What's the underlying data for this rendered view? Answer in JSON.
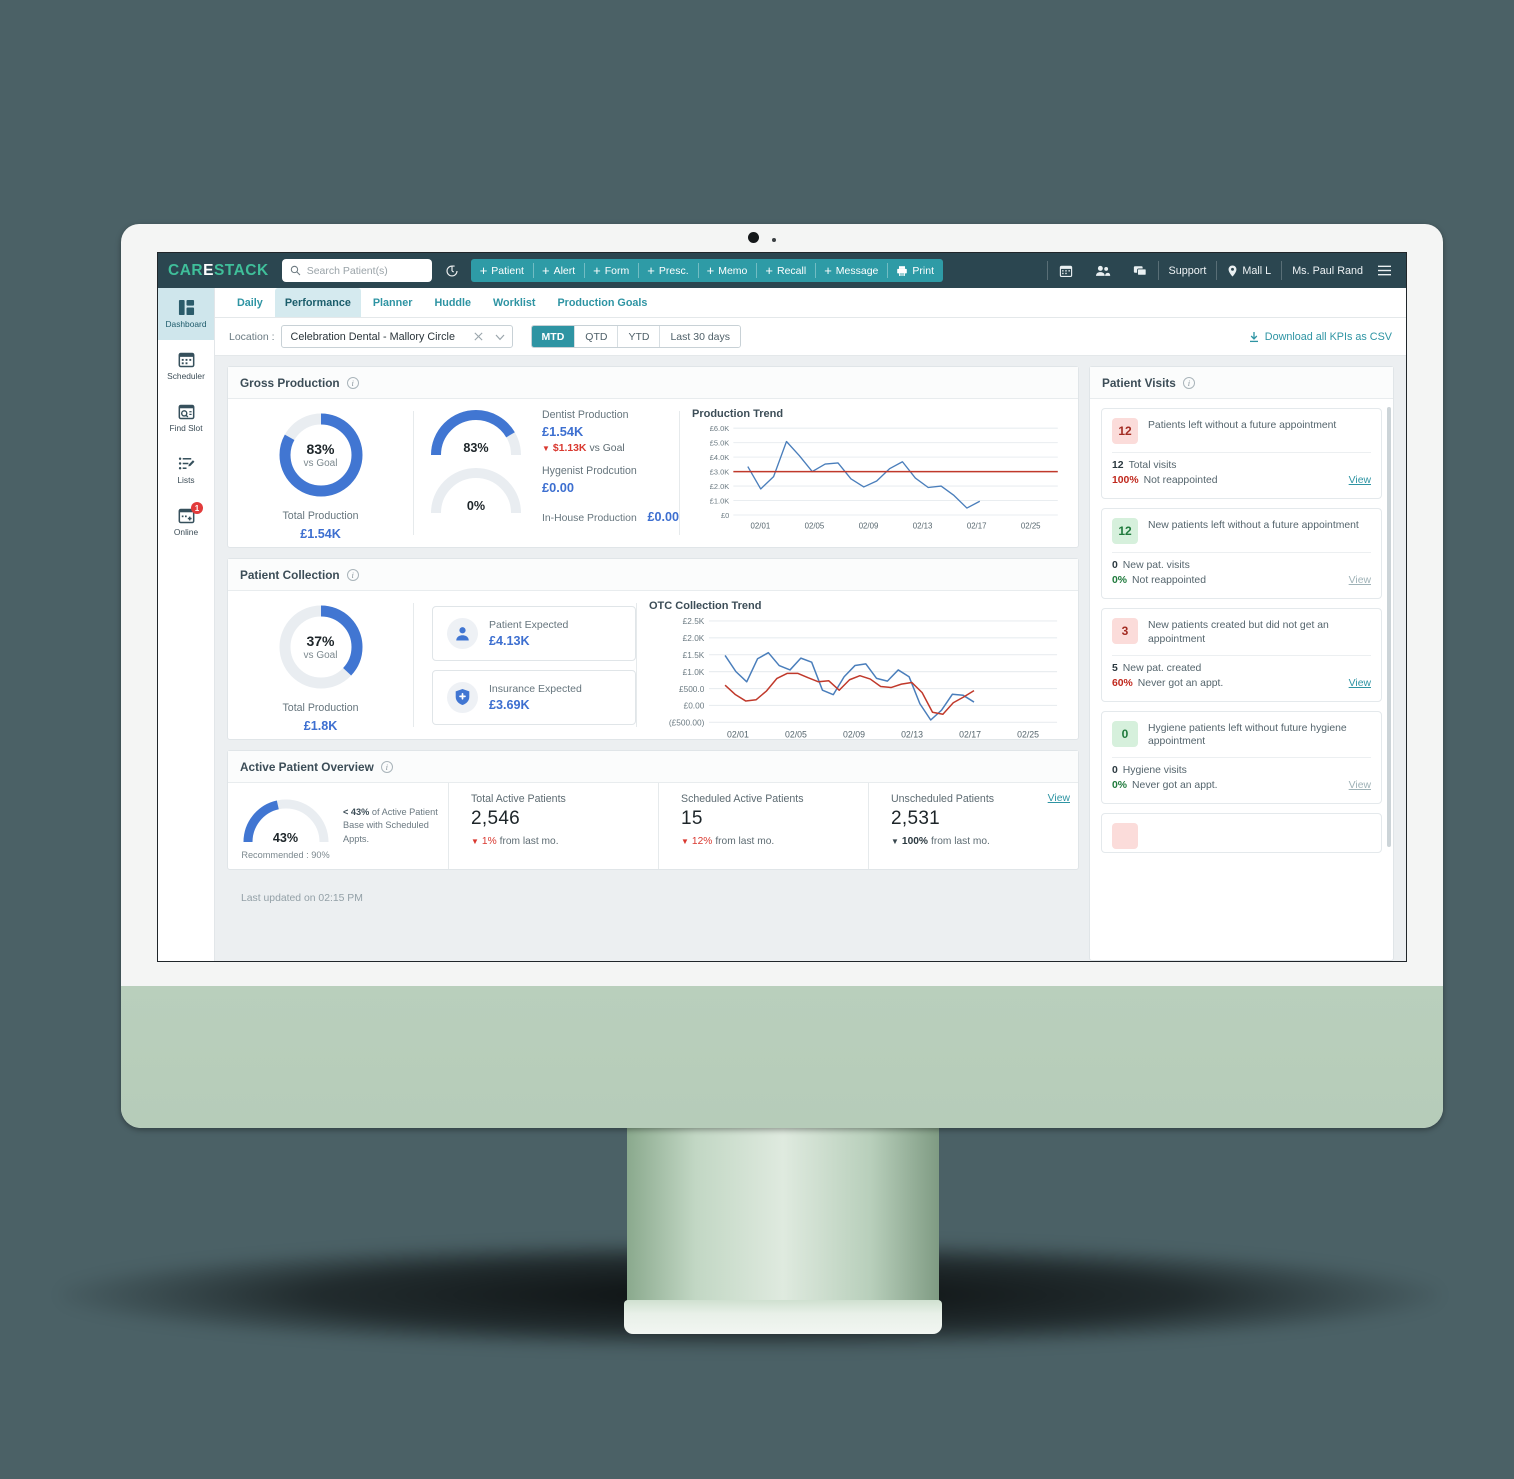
{
  "topbar": {
    "logo": {
      "part1": "CAR",
      "part2": "E",
      "part3": "STACK"
    },
    "search_placeholder": "Search Patient(s)",
    "search_value": "",
    "clock_icon": "recent-history-icon",
    "actions": [
      {
        "label": "Patient",
        "icon": "plus-icon"
      },
      {
        "label": "Alert",
        "icon": "plus-icon"
      },
      {
        "label": "Form",
        "icon": "plus-icon"
      },
      {
        "label": "Presc.",
        "icon": "plus-icon"
      },
      {
        "label": "Memo",
        "icon": "plus-icon"
      },
      {
        "label": "Recall",
        "icon": "plus-icon"
      },
      {
        "label": "Message",
        "icon": "plus-icon"
      },
      {
        "label": "Print",
        "icon": "printer-icon"
      }
    ],
    "right_icons": [
      "calendar-icon",
      "people-icon",
      "chat-icon"
    ],
    "support_label": "Support",
    "location_label": "Mall L",
    "user_label": "Ms. Paul Rand",
    "menu_icon": "hamburger-icon"
  },
  "rail": [
    {
      "label": "Dashboard",
      "icon": "dashboard-icon",
      "active": true,
      "badge": ""
    },
    {
      "label": "Scheduler",
      "icon": "calendar-icon",
      "active": false,
      "badge": ""
    },
    {
      "label": "Find Slot",
      "icon": "calendar-search-icon",
      "active": false,
      "badge": ""
    },
    {
      "label": "Lists",
      "icon": "list-edit-icon",
      "active": false,
      "badge": ""
    },
    {
      "label": "Online",
      "icon": "calendar-plus-icon",
      "active": false,
      "badge": "1"
    }
  ],
  "tabs": [
    {
      "label": "Daily",
      "active": false
    },
    {
      "label": "Performance",
      "active": true
    },
    {
      "label": "Planner",
      "active": false
    },
    {
      "label": "Huddle",
      "active": false
    },
    {
      "label": "Worklist",
      "active": false
    },
    {
      "label": "Production Goals",
      "active": false
    }
  ],
  "filterbar": {
    "location_label": "Location :",
    "location_value": "Celebration Dental - Mallory Circle",
    "clear_icon": "close-icon",
    "dropdown_icon": "chevron-down-icon",
    "ranges": [
      {
        "label": "MTD",
        "active": true
      },
      {
        "label": "QTD",
        "active": false
      },
      {
        "label": "YTD",
        "active": false
      },
      {
        "label": "Last 30 days",
        "active": false
      }
    ],
    "csv_label": "Download all KPIs as CSV",
    "csv_icon": "download-icon"
  },
  "gross_production": {
    "title": "Gross Production",
    "donut": {
      "percent": 83,
      "percent_label": "83%",
      "sub": "vs Goal"
    },
    "caption": "Total Production",
    "value": "£1.54K",
    "gauges": [
      {
        "percent": 83,
        "percent_label": "83%",
        "caption": ""
      },
      {
        "percent": 0,
        "percent_label": "0%",
        "caption": "In-House Production"
      }
    ],
    "dentist_label": "Dentist Production",
    "dentist_value": "£1.54K",
    "dentist_delta_amount": "$1.13K",
    "dentist_delta_suffix": "vs Goal",
    "hygenist_label": "Hygenist Prodcution",
    "hygenist_value": "£0.00",
    "inhouse_label": "In-House Production",
    "inhouse_value": "£0.00"
  },
  "patient_collection": {
    "title": "Patient Collection",
    "donut": {
      "percent": 37,
      "percent_label": "37%",
      "sub": "vs Goal"
    },
    "caption": "Total Production",
    "value": "£1.8K",
    "tiles": [
      {
        "label": "Patient Expected",
        "value": "£4.13K",
        "icon": "person-icon"
      },
      {
        "label": "Insurance Expected",
        "value": "£3.69K",
        "icon": "shield-plus-icon"
      }
    ]
  },
  "active_patient_overview": {
    "title": "Active Patient Overview",
    "gauge": {
      "percent": 43,
      "percent_label": "43%"
    },
    "recommended": "Recommended : 90%",
    "note_prefix": "< 43%",
    "note_rest": " of Active Patient Base with Scheduled Appts.",
    "metrics": [
      {
        "label": "Total Active Patients",
        "value": "2,546",
        "delta": "1%",
        "delta_suffix": "from last mo.",
        "view": ""
      },
      {
        "label": "Scheduled Active Patients",
        "value": "15",
        "delta": "12%",
        "delta_suffix": "from last mo.",
        "view": ""
      },
      {
        "label": "Unscheduled Patients",
        "value": "2,531",
        "delta": "100%",
        "delta_suffix": "from last mo.",
        "view": "View"
      }
    ]
  },
  "footer": {
    "last_updated": "Last updated on 02:15 PM"
  },
  "patient_visits": {
    "title": "Patient Visits",
    "items": [
      {
        "badge": "12",
        "badge_color": "red",
        "desc": "Patients left without a future appointment",
        "stat1_value": "12",
        "stat1_label": "Total visits",
        "stat2_value": "100%",
        "stat2_label": "Not reappointed",
        "stat2_color": "red",
        "view": "View",
        "view_muted": false
      },
      {
        "badge": "12",
        "badge_color": "green",
        "desc": "New patients left without a future appointment",
        "stat1_value": "0",
        "stat1_label": "New pat. visits",
        "stat2_value": "0%",
        "stat2_label": "Not reappointed",
        "stat2_color": "green",
        "view": "View",
        "view_muted": true
      },
      {
        "badge": "3",
        "badge_color": "red",
        "desc": "New patients created but did not get an appointment",
        "stat1_value": "5",
        "stat1_label": "New pat. created",
        "stat2_value": "60%",
        "stat2_label": "Never got an appt.",
        "stat2_color": "red",
        "view": "View",
        "view_muted": false
      },
      {
        "badge": "0",
        "badge_color": "green",
        "desc": "Hygiene patients left without future hygiene appointment",
        "stat1_value": "0",
        "stat1_label": "Hygiene visits",
        "stat2_value": "0%",
        "stat2_label": "Never got an appt.",
        "stat2_color": "green",
        "view": "View",
        "view_muted": true
      }
    ]
  },
  "chart_data": [
    {
      "type": "line",
      "title": "Production Trend",
      "xlabel": "",
      "ylabel": "",
      "ylim": [
        0,
        6000
      ],
      "yticks": [
        0,
        1000,
        2000,
        3000,
        4000,
        5000,
        6000
      ],
      "ytick_labels": [
        "£0",
        "£1.0K",
        "£2.0K",
        "£3.0K",
        "£4.0K",
        "£5.0K",
        "£6.0K"
      ],
      "xtick_labels": [
        "02/01",
        "02/05",
        "02/09",
        "02/13",
        "02/17",
        "02/25"
      ],
      "grid": true,
      "legend": "none",
      "series": [
        {
          "name": "Production",
          "color": "#4a7ebb",
          "x": [
            0,
            1,
            2,
            3,
            4,
            5,
            6,
            7,
            8,
            9,
            10,
            11,
            12,
            13,
            14,
            15,
            16,
            17,
            18
          ],
          "values": [
            3350,
            1800,
            2650,
            5080,
            4100,
            3000,
            3520,
            3600,
            2500,
            1940,
            2350,
            3200,
            3680,
            2550,
            1900,
            2000,
            1350,
            480,
            950
          ]
        },
        {
          "name": "Goal",
          "color": "#c0392b",
          "type": "hline",
          "value": 3000
        }
      ]
    },
    {
      "type": "line",
      "title": "OTC Collection Trend",
      "xlabel": "",
      "ylabel": "",
      "ylim": [
        -500,
        2500
      ],
      "yticks": [
        -500,
        0,
        500,
        1000,
        1500,
        2000,
        2500
      ],
      "ytick_labels": [
        "(£500.00)",
        "£0.00",
        "£500.0",
        "£1.0K",
        "£1.5K",
        "£2.0K",
        "£2.5K"
      ],
      "xtick_labels": [
        "02/01",
        "02/05",
        "02/09",
        "02/13",
        "02/17",
        "02/25"
      ],
      "grid": true,
      "legend": "none",
      "series": [
        {
          "name": "Collection",
          "color": "#4a7ebb",
          "values": [
            1480,
            1000,
            700,
            1380,
            1560,
            1180,
            1050,
            1400,
            1280,
            450,
            320,
            850,
            1180,
            1230,
            800,
            720,
            1050,
            850,
            50,
            -430,
            -140,
            330,
            300,
            100
          ]
        },
        {
          "name": "Expected",
          "color": "#c0392b",
          "values": [
            600,
            320,
            130,
            170,
            430,
            800,
            950,
            950,
            820,
            700,
            730,
            450,
            760,
            880,
            780,
            560,
            530,
            630,
            680,
            380,
            -200,
            -260,
            80,
            250,
            440
          ]
        }
      ]
    }
  ]
}
